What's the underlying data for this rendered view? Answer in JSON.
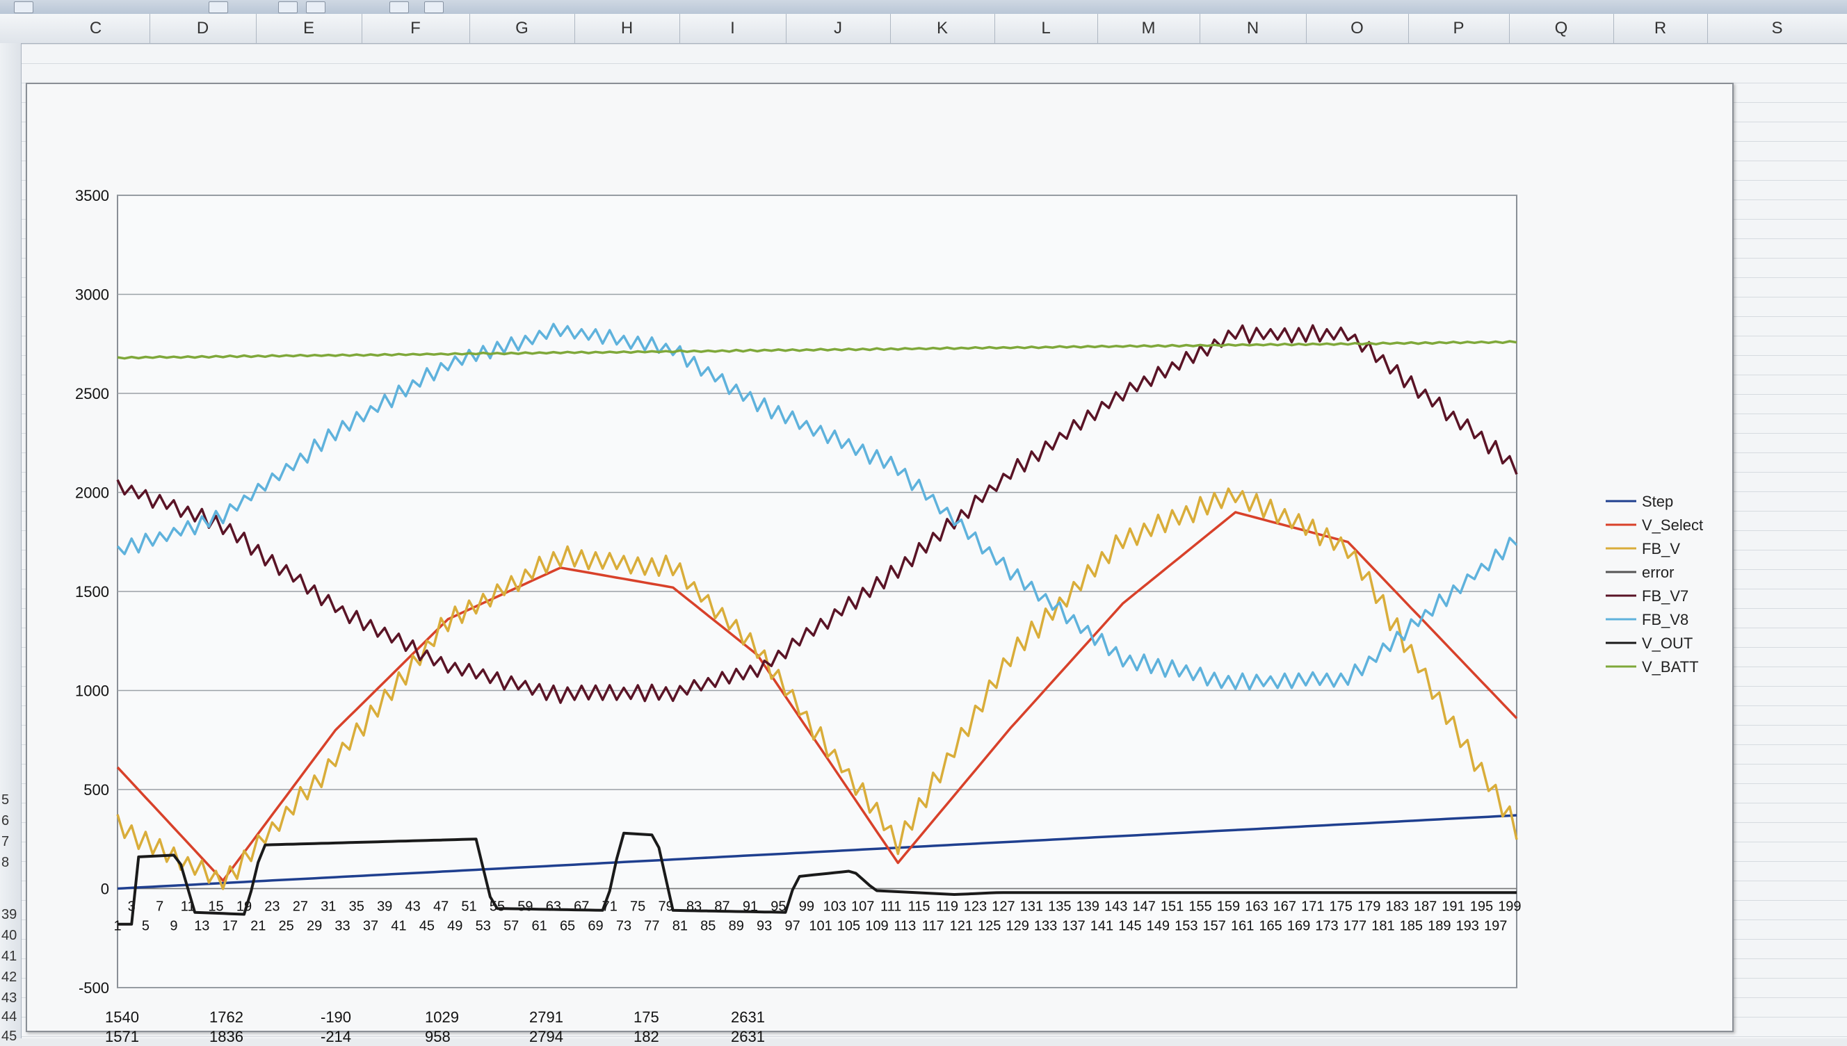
{
  "spreadsheet": {
    "columns": [
      "C",
      "D",
      "E",
      "F",
      "G",
      "H",
      "I",
      "J",
      "K",
      "L",
      "M",
      "N",
      "O",
      "P",
      "Q",
      "R",
      "S"
    ],
    "row_numbers": [
      "5",
      "6",
      "7",
      "8",
      "39",
      "40",
      "41",
      "42",
      "43",
      "44",
      "45"
    ],
    "visible_rows": [
      {
        "row": "44",
        "cells": [
          "1540",
          "1762",
          "-190",
          "1029",
          "2791",
          "175",
          "2631"
        ]
      },
      {
        "row": "45",
        "cells": [
          "1571",
          "1836",
          "-214",
          "958",
          "2794",
          "182",
          "2631"
        ]
      }
    ]
  },
  "colors": {
    "Step": "#1f3f8f",
    "V_Select": "#d8412a",
    "FB_V": "#d9ad3a",
    "error": "#555555",
    "FB_V7": "#5a1426",
    "FB_V8": "#5fb2dc",
    "V_OUT": "#1a1a1a",
    "V_BATT": "#7fa83a"
  },
  "chart_data": {
    "type": "line",
    "ylim": [
      -500,
      3500
    ],
    "y_ticks": [
      "3500",
      "3000",
      "2500",
      "2000",
      "1500",
      "1000",
      "500",
      "0",
      "-500"
    ],
    "x_tick_labels_odd_upper": [
      "3",
      "7",
      "11",
      "15",
      "19",
      "23",
      "27",
      "31",
      "35",
      "39",
      "43",
      "47",
      "51",
      "55",
      "59",
      "63",
      "67",
      "71",
      "75",
      "79",
      "83",
      "87",
      "91",
      "95",
      "99",
      "103",
      "107",
      "111",
      "115",
      "119",
      "123",
      "127",
      "131",
      "135",
      "139",
      "143",
      "147",
      "151",
      "155",
      "159",
      "163",
      "167",
      "171",
      "175",
      "179",
      "183",
      "187",
      "191",
      "195",
      "199"
    ],
    "x_tick_labels_odd_lower": [
      "1",
      "5",
      "9",
      "13",
      "17",
      "21",
      "25",
      "29",
      "33",
      "37",
      "41",
      "45",
      "49",
      "53",
      "57",
      "61",
      "65",
      "69",
      "73",
      "77",
      "81",
      "85",
      "89",
      "93",
      "97",
      "101",
      "105",
      "109",
      "113",
      "117",
      "121",
      "125",
      "129",
      "133",
      "137",
      "141",
      "145",
      "149",
      "153",
      "157",
      "161",
      "165",
      "169",
      "173",
      "177",
      "181",
      "185",
      "189",
      "193",
      "197"
    ],
    "x_count": 200,
    "legend_position": "right",
    "series": [
      {
        "name": "Step",
        "key": "Step",
        "model": "linear",
        "from": 0,
        "to": 370
      },
      {
        "name": "V_Select",
        "key": "V_Select",
        "points": [
          [
            1,
            620
          ],
          [
            20,
            40
          ],
          [
            40,
            800
          ],
          [
            60,
            1360
          ],
          [
            80,
            1620
          ],
          [
            100,
            1520
          ],
          [
            115,
            1180
          ],
          [
            140,
            130
          ],
          [
            160,
            810
          ],
          [
            180,
            1440
          ],
          [
            200,
            1900
          ],
          [
            220,
            1750
          ],
          [
            250,
            860
          ]
        ]
      },
      {
        "name": "FB_V",
        "key": "FB_V",
        "points": [
          [
            1,
            320
          ],
          [
            20,
            30
          ],
          [
            40,
            650
          ],
          [
            60,
            1350
          ],
          [
            80,
            1680
          ],
          [
            100,
            1620
          ],
          [
            115,
            1200
          ],
          [
            140,
            230
          ],
          [
            160,
            1180
          ],
          [
            180,
            1760
          ],
          [
            200,
            1990
          ],
          [
            220,
            1720
          ],
          [
            250,
            300
          ]
        ]
      },
      {
        "name": "error",
        "key": "error",
        "points": []
      },
      {
        "name": "FB_V7",
        "key": "FB_V7",
        "points": [
          [
            1,
            2040
          ],
          [
            20,
            1830
          ],
          [
            40,
            1420
          ],
          [
            60,
            1120
          ],
          [
            80,
            980
          ],
          [
            100,
            990
          ],
          [
            115,
            1100
          ],
          [
            140,
            1610
          ],
          [
            160,
            2100
          ],
          [
            180,
            2500
          ],
          [
            200,
            2800
          ],
          [
            220,
            2800
          ],
          [
            250,
            2130
          ]
        ]
      },
      {
        "name": "FB_V8",
        "key": "FB_V8",
        "points": [
          [
            1,
            1700
          ],
          [
            20,
            1880
          ],
          [
            40,
            2300
          ],
          [
            60,
            2650
          ],
          [
            80,
            2820
          ],
          [
            100,
            2720
          ],
          [
            115,
            2450
          ],
          [
            140,
            2120
          ],
          [
            160,
            1600
          ],
          [
            180,
            1160
          ],
          [
            200,
            1040
          ],
          [
            220,
            1060
          ],
          [
            250,
            1760
          ]
        ]
      },
      {
        "name": "V_OUT",
        "key": "V_OUT",
        "points": [
          [
            1,
            -180
          ],
          [
            4,
            -180
          ],
          [
            5,
            160
          ],
          [
            12,
            170
          ],
          [
            15,
            -120
          ],
          [
            24,
            -130
          ],
          [
            27,
            220
          ],
          [
            65,
            250
          ],
          [
            68,
            -100
          ],
          [
            88,
            -110
          ],
          [
            91,
            280
          ],
          [
            97,
            270
          ],
          [
            100,
            -110
          ],
          [
            120,
            -120
          ],
          [
            122,
            60
          ],
          [
            132,
            90
          ],
          [
            136,
            -10
          ],
          [
            150,
            -30
          ],
          [
            158,
            -20
          ]
        ]
      },
      {
        "name": "V_BATT",
        "key": "V_BATT",
        "model": "flat",
        "from": 2680,
        "to": 2760
      }
    ]
  }
}
